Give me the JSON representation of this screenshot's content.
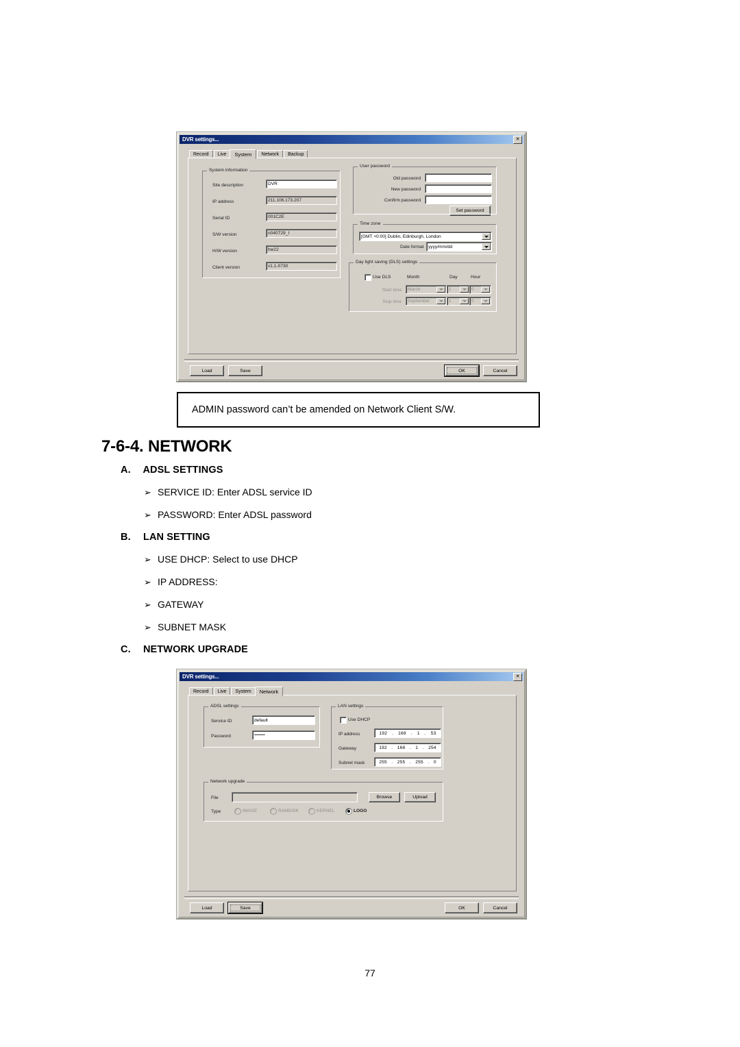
{
  "document": {
    "page_number": "77",
    "heading": "7-6-4. NETWORK",
    "note_box_text": "ADMIN password can’t be amended on Network Client S/W.",
    "sections": [
      {
        "label": "A.",
        "title": "ADSL SETTINGS",
        "bullets": [
          "SERVICE ID: Enter ADSL service ID",
          "PASSWORD: Enter ADSL password"
        ]
      },
      {
        "label": "B.",
        "title": "LAN SETTING",
        "bullets": [
          "USE DHCP: Select to use DHCP",
          "IP ADDRESS:",
          "GATEWAY",
          "SUBNET MASK"
        ]
      },
      {
        "label": "C.",
        "title": "NETWORK UPGRADE",
        "bullets": []
      }
    ],
    "bullet_glyph": "➢"
  },
  "dialog_system": {
    "title": "DVR settings...",
    "close_label": "✕",
    "tabs": [
      {
        "label": "Record",
        "active": false
      },
      {
        "label": "Live",
        "active": false
      },
      {
        "label": "System",
        "active": true
      },
      {
        "label": "Network",
        "active": false
      },
      {
        "label": "Backup",
        "active": false
      }
    ],
    "system_information": {
      "group_title": "System information",
      "rows": [
        {
          "label": "Site description",
          "value": "DVR",
          "readonly": false
        },
        {
          "label": "IP address",
          "value": "211.106.173.207",
          "readonly": true
        },
        {
          "label": "Serial ID",
          "value": "001C2E",
          "readonly": true
        },
        {
          "label": "S/W version",
          "value": "n040729_I",
          "readonly": true
        },
        {
          "label": "H/W version",
          "value": "hw22",
          "readonly": true
        },
        {
          "label": "Client version",
          "value": "v1.1-0730",
          "readonly": true
        }
      ]
    },
    "user_password": {
      "group_title": "User password",
      "rows": [
        {
          "label": "Old password",
          "value": ""
        },
        {
          "label": "New password",
          "value": ""
        },
        {
          "label": "Confirm password",
          "value": ""
        }
      ],
      "set_password_label": "Set password"
    },
    "time_zone": {
      "group_title": "Time zone",
      "zone_value": "[GMT +0:00] Dublin, Edinburgh, London",
      "date_format_label": "Date format",
      "date_format_value": "yyyy/mm/dd"
    },
    "dls": {
      "group_title": "Day light saving (DLS) settings",
      "use_dls_label": "Use DLS",
      "use_dls_checked": false,
      "columns": [
        "Month",
        "Day",
        "Hour"
      ],
      "start_label": "Start time",
      "start_month": "March",
      "start_day": "1",
      "start_hour": "0",
      "stop_label": "Stop time",
      "stop_month": "September",
      "stop_day": "1",
      "stop_hour": "0"
    },
    "footer": {
      "load": "Load",
      "save": "Save",
      "ok": "OK",
      "cancel": "Cancel",
      "focused": "OK"
    }
  },
  "dialog_network": {
    "title": "DVR settings...",
    "close_label": "✕",
    "tabs": [
      {
        "label": "Record",
        "active": false
      },
      {
        "label": "Live",
        "active": false
      },
      {
        "label": "System",
        "active": false
      },
      {
        "label": "Network",
        "active": true
      }
    ],
    "adsl_settings": {
      "group_title": "ADSL settings",
      "service_id_label": "Service ID",
      "service_id_value": "default",
      "password_label": "Password",
      "password_value": "•••••••••"
    },
    "lan_settings": {
      "group_title": "LAN settings",
      "use_dhcp_label": "Use DHCP",
      "use_dhcp_checked": false,
      "ip_address_label": "IP address",
      "ip_address": [
        "192",
        "168",
        "1",
        "53"
      ],
      "gateway_label": "Gateway",
      "gateway": [
        "192",
        "168",
        "1",
        "254"
      ],
      "subnet_mask_label": "Subnet mask",
      "subnet_mask": [
        "255",
        "255",
        "255",
        "0"
      ]
    },
    "network_upgrade": {
      "group_title": "Network upgrade",
      "file_label": "File",
      "file_value": "",
      "browse_label": "Browse",
      "upload_label": "Upload",
      "type_label": "Type",
      "types": [
        {
          "label": "IMAGE",
          "selected": false,
          "disabled": true
        },
        {
          "label": "RAMDISK",
          "selected": false,
          "disabled": true
        },
        {
          "label": "KERNEL",
          "selected": false,
          "disabled": true
        },
        {
          "label": "LOGO",
          "selected": true,
          "disabled": false
        }
      ]
    },
    "footer": {
      "load": "Load",
      "save": "Save",
      "ok": "OK",
      "cancel": "Cancel",
      "focused": "Save"
    }
  }
}
